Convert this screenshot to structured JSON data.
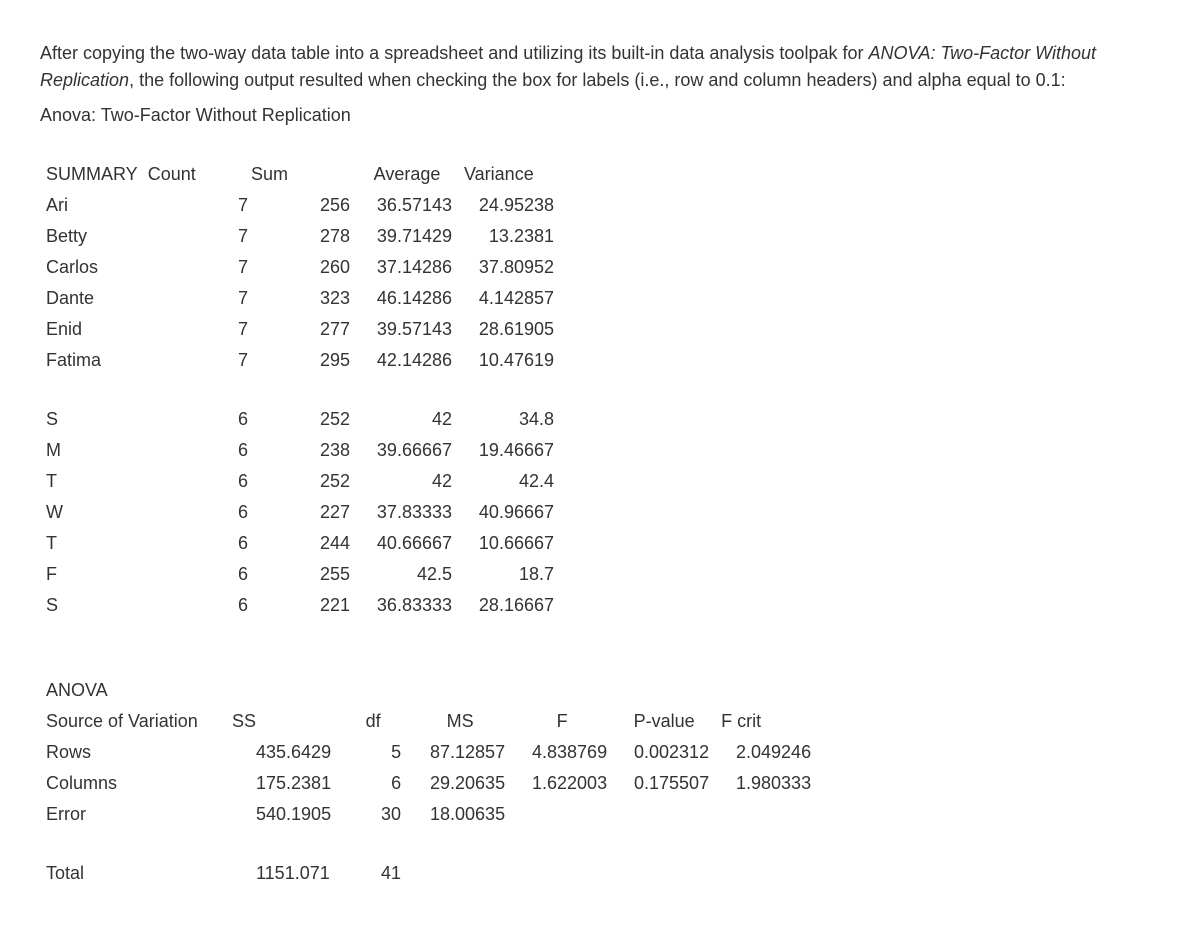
{
  "intro": {
    "part1": "After copying the two-way data table into a spreadsheet and utilizing its built-in data analysis toolpak for ",
    "ital1": "ANOVA: Two-Factor Without Replication",
    "part2": ", the following output resulted when checking the box for labels (i.e., row and column headers) and alpha equal to 0.1:"
  },
  "subtitle": "Anova: Two-Factor Without Replication",
  "summary": {
    "headers": {
      "label": "SUMMARY",
      "count": "Count",
      "sum": "Sum",
      "average": "Average",
      "variance": "Variance"
    },
    "rows": [
      {
        "label": "Ari",
        "count": "7",
        "sum": "256",
        "average": "36.57143",
        "variance": "24.95238"
      },
      {
        "label": "Betty",
        "count": "7",
        "sum": "278",
        "average": "39.71429",
        "variance": "13.2381"
      },
      {
        "label": "Carlos",
        "count": "7",
        "sum": "260",
        "average": "37.14286",
        "variance": "37.80952"
      },
      {
        "label": "Dante",
        "count": "7",
        "sum": "323",
        "average": "46.14286",
        "variance": "4.142857"
      },
      {
        "label": "Enid",
        "count": "7",
        "sum": "277",
        "average": "39.57143",
        "variance": "28.61905"
      },
      {
        "label": "Fatima",
        "count": "7",
        "sum": "295",
        "average": "42.14286",
        "variance": "10.47619"
      }
    ],
    "cols": [
      {
        "label": "S",
        "count": "6",
        "sum": "252",
        "average": "42",
        "variance": "34.8"
      },
      {
        "label": "M",
        "count": "6",
        "sum": "238",
        "average": "39.66667",
        "variance": "19.46667"
      },
      {
        "label": "T",
        "count": "6",
        "sum": "252",
        "average": "42",
        "variance": "42.4"
      },
      {
        "label": "W",
        "count": "6",
        "sum": "227",
        "average": "37.83333",
        "variance": "40.96667"
      },
      {
        "label": "T",
        "count": "6",
        "sum": "244",
        "average": "40.66667",
        "variance": "10.66667"
      },
      {
        "label": "F",
        "count": "6",
        "sum": "255",
        "average": "42.5",
        "variance": "18.7"
      },
      {
        "label": "S",
        "count": "6",
        "sum": "221",
        "average": "36.83333",
        "variance": "28.16667"
      }
    ]
  },
  "anova": {
    "title": "ANOVA",
    "headers": {
      "source": "Source of Variation",
      "ss": "SS",
      "df": "df",
      "ms": "MS",
      "f": "F",
      "p": "P-value",
      "fc": "F crit"
    },
    "rows": [
      {
        "source": "Rows",
        "ss": "435.6429",
        "df": "5",
        "ms": "87.12857",
        "f": "4.838769",
        "p": "0.002312",
        "fc": "2.049246"
      },
      {
        "source": "Columns",
        "ss": "175.2381",
        "df": "6",
        "ms": "29.20635",
        "f": "1.622003",
        "p": "0.175507",
        "fc": "1.980333"
      },
      {
        "source": "Error",
        "ss": "540.1905",
        "df": "30",
        "ms": "18.00635",
        "f": "",
        "p": "",
        "fc": ""
      }
    ],
    "total": {
      "source": "Total",
      "ss": "1151.071",
      "df": "41"
    }
  }
}
